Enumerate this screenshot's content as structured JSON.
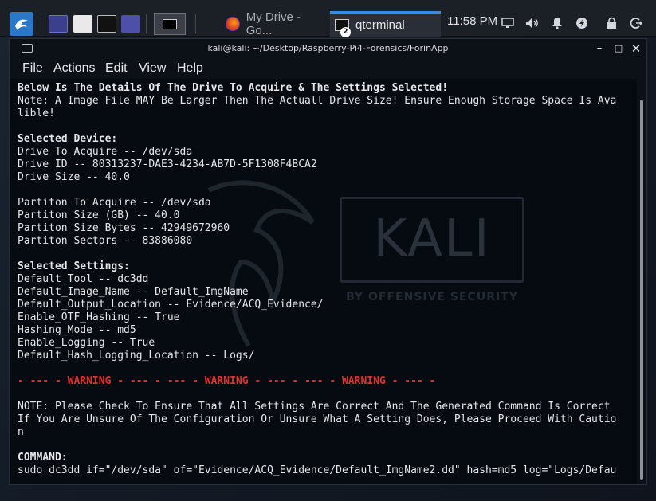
{
  "taskbar": {
    "tasks": [
      {
        "label": "My Drive - Go..."
      },
      {
        "label": "qterminal",
        "badge": "2"
      }
    ],
    "clock": "11:58 PM"
  },
  "window": {
    "title": "kali@kali: ~/Desktop/Raspberry-Pi4-Forensics/ForinApp",
    "menus": [
      "File",
      "Actions",
      "Edit",
      "View",
      "Help"
    ]
  },
  "background": {
    "brand": "KALI",
    "brand_sub": "BY OFFENSIVE SECURITY"
  },
  "terminal": {
    "lines": [
      {
        "text": "Below Is The Details Of The Drive To Acquire & The Settings Selected!",
        "style": "bold"
      },
      {
        "text": "Note: A Image File MAY Be Larger Then The Actuall Drive Size! Ensure Enough Storage Space Is Ava",
        "style": "normal"
      },
      {
        "text": "lible!",
        "style": "normal"
      },
      {
        "text": "",
        "style": "normal"
      },
      {
        "text": "Selected Device:",
        "style": "bold"
      },
      {
        "text": "Drive To Acquire -- /dev/sda",
        "style": "normal"
      },
      {
        "text": "Drive ID -- 80313237-DAE3-4234-AB7D-5F1308F4BCA2",
        "style": "normal"
      },
      {
        "text": "Drive Size -- 40.0",
        "style": "normal"
      },
      {
        "text": "",
        "style": "normal"
      },
      {
        "text": "Partiton To Acquire -- /dev/sda",
        "style": "normal"
      },
      {
        "text": "Partiton Size (GB) -- 40.0",
        "style": "normal"
      },
      {
        "text": "Partiton Size Bytes -- 42949672960",
        "style": "normal"
      },
      {
        "text": "Partiton Sectors -- 83886080",
        "style": "normal"
      },
      {
        "text": "",
        "style": "normal"
      },
      {
        "text": "Selected Settings:",
        "style": "bold"
      },
      {
        "text": "Default_Tool -- dc3dd",
        "style": "normal"
      },
      {
        "text": "Default_Image_Name -- Default_ImgName",
        "style": "normal"
      },
      {
        "text": "Default_Output_Location -- Evidence/ACQ_Evidence/",
        "style": "normal"
      },
      {
        "text": "Enable_OTF_Hashing -- True",
        "style": "normal"
      },
      {
        "text": "Hashing_Mode -- md5",
        "style": "normal"
      },
      {
        "text": "Enable_Logging -- True",
        "style": "normal"
      },
      {
        "text": "Default_Hash_Logging_Location -- Logs/",
        "style": "normal"
      },
      {
        "text": "",
        "style": "normal"
      },
      {
        "text": "- --- - WARNING - --- - --- - WARNING - --- - --- - WARNING - --- -",
        "style": "warn"
      },
      {
        "text": "",
        "style": "normal"
      },
      {
        "text": "NOTE: Please Check To Ensure That All Settings Are Correct And The Generated Command Is Correct",
        "style": "normal"
      },
      {
        "text": "If You Are Unsure Of The Configuration Or Unsure What A Setting Does, Please Proceed With Cautio",
        "style": "normal"
      },
      {
        "text": "n",
        "style": "normal"
      },
      {
        "text": "",
        "style": "normal"
      },
      {
        "text": "COMMAND:",
        "style": "bold"
      },
      {
        "text": "sudo dc3dd if=\"/dev/sda\" of=\"Evidence/ACQ_Evidence/Default_ImgName2.dd\" hash=md5 log=\"Logs/Defau",
        "style": "normal"
      }
    ]
  }
}
